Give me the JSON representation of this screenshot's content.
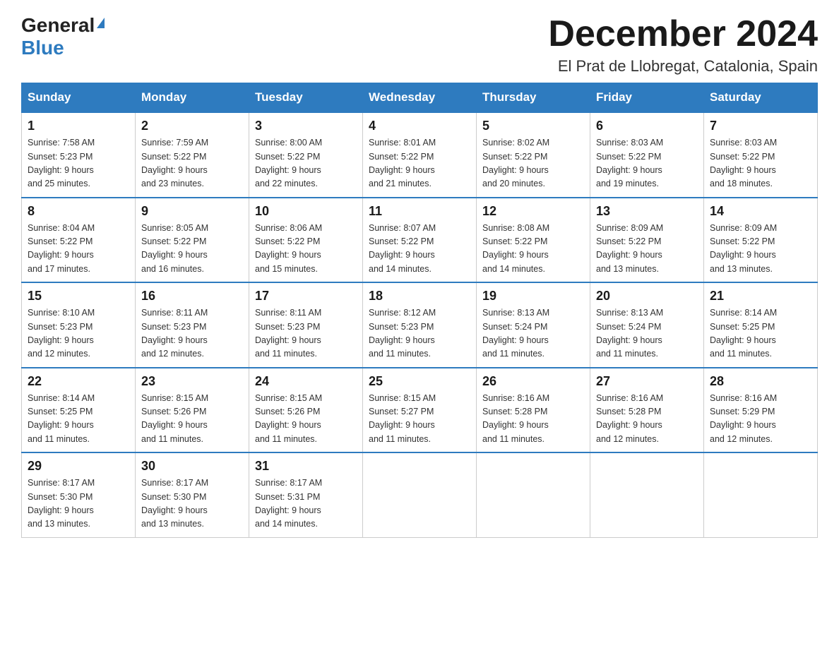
{
  "header": {
    "logo": {
      "general": "General",
      "blue": "Blue",
      "arrow": "▲"
    },
    "title": "December 2024",
    "location": "El Prat de Llobregat, Catalonia, Spain"
  },
  "calendar": {
    "headers": [
      "Sunday",
      "Monday",
      "Tuesday",
      "Wednesday",
      "Thursday",
      "Friday",
      "Saturday"
    ],
    "weeks": [
      [
        {
          "day": "1",
          "info": "Sunrise: 7:58 AM\nSunset: 5:23 PM\nDaylight: 9 hours\nand 25 minutes."
        },
        {
          "day": "2",
          "info": "Sunrise: 7:59 AM\nSunset: 5:22 PM\nDaylight: 9 hours\nand 23 minutes."
        },
        {
          "day": "3",
          "info": "Sunrise: 8:00 AM\nSunset: 5:22 PM\nDaylight: 9 hours\nand 22 minutes."
        },
        {
          "day": "4",
          "info": "Sunrise: 8:01 AM\nSunset: 5:22 PM\nDaylight: 9 hours\nand 21 minutes."
        },
        {
          "day": "5",
          "info": "Sunrise: 8:02 AM\nSunset: 5:22 PM\nDaylight: 9 hours\nand 20 minutes."
        },
        {
          "day": "6",
          "info": "Sunrise: 8:03 AM\nSunset: 5:22 PM\nDaylight: 9 hours\nand 19 minutes."
        },
        {
          "day": "7",
          "info": "Sunrise: 8:03 AM\nSunset: 5:22 PM\nDaylight: 9 hours\nand 18 minutes."
        }
      ],
      [
        {
          "day": "8",
          "info": "Sunrise: 8:04 AM\nSunset: 5:22 PM\nDaylight: 9 hours\nand 17 minutes."
        },
        {
          "day": "9",
          "info": "Sunrise: 8:05 AM\nSunset: 5:22 PM\nDaylight: 9 hours\nand 16 minutes."
        },
        {
          "day": "10",
          "info": "Sunrise: 8:06 AM\nSunset: 5:22 PM\nDaylight: 9 hours\nand 15 minutes."
        },
        {
          "day": "11",
          "info": "Sunrise: 8:07 AM\nSunset: 5:22 PM\nDaylight: 9 hours\nand 14 minutes."
        },
        {
          "day": "12",
          "info": "Sunrise: 8:08 AM\nSunset: 5:22 PM\nDaylight: 9 hours\nand 14 minutes."
        },
        {
          "day": "13",
          "info": "Sunrise: 8:09 AM\nSunset: 5:22 PM\nDaylight: 9 hours\nand 13 minutes."
        },
        {
          "day": "14",
          "info": "Sunrise: 8:09 AM\nSunset: 5:22 PM\nDaylight: 9 hours\nand 13 minutes."
        }
      ],
      [
        {
          "day": "15",
          "info": "Sunrise: 8:10 AM\nSunset: 5:23 PM\nDaylight: 9 hours\nand 12 minutes."
        },
        {
          "day": "16",
          "info": "Sunrise: 8:11 AM\nSunset: 5:23 PM\nDaylight: 9 hours\nand 12 minutes."
        },
        {
          "day": "17",
          "info": "Sunrise: 8:11 AM\nSunset: 5:23 PM\nDaylight: 9 hours\nand 11 minutes."
        },
        {
          "day": "18",
          "info": "Sunrise: 8:12 AM\nSunset: 5:23 PM\nDaylight: 9 hours\nand 11 minutes."
        },
        {
          "day": "19",
          "info": "Sunrise: 8:13 AM\nSunset: 5:24 PM\nDaylight: 9 hours\nand 11 minutes."
        },
        {
          "day": "20",
          "info": "Sunrise: 8:13 AM\nSunset: 5:24 PM\nDaylight: 9 hours\nand 11 minutes."
        },
        {
          "day": "21",
          "info": "Sunrise: 8:14 AM\nSunset: 5:25 PM\nDaylight: 9 hours\nand 11 minutes."
        }
      ],
      [
        {
          "day": "22",
          "info": "Sunrise: 8:14 AM\nSunset: 5:25 PM\nDaylight: 9 hours\nand 11 minutes."
        },
        {
          "day": "23",
          "info": "Sunrise: 8:15 AM\nSunset: 5:26 PM\nDaylight: 9 hours\nand 11 minutes."
        },
        {
          "day": "24",
          "info": "Sunrise: 8:15 AM\nSunset: 5:26 PM\nDaylight: 9 hours\nand 11 minutes."
        },
        {
          "day": "25",
          "info": "Sunrise: 8:15 AM\nSunset: 5:27 PM\nDaylight: 9 hours\nand 11 minutes."
        },
        {
          "day": "26",
          "info": "Sunrise: 8:16 AM\nSunset: 5:28 PM\nDaylight: 9 hours\nand 11 minutes."
        },
        {
          "day": "27",
          "info": "Sunrise: 8:16 AM\nSunset: 5:28 PM\nDaylight: 9 hours\nand 12 minutes."
        },
        {
          "day": "28",
          "info": "Sunrise: 8:16 AM\nSunset: 5:29 PM\nDaylight: 9 hours\nand 12 minutes."
        }
      ],
      [
        {
          "day": "29",
          "info": "Sunrise: 8:17 AM\nSunset: 5:30 PM\nDaylight: 9 hours\nand 13 minutes."
        },
        {
          "day": "30",
          "info": "Sunrise: 8:17 AM\nSunset: 5:30 PM\nDaylight: 9 hours\nand 13 minutes."
        },
        {
          "day": "31",
          "info": "Sunrise: 8:17 AM\nSunset: 5:31 PM\nDaylight: 9 hours\nand 14 minutes."
        },
        {
          "day": "",
          "info": ""
        },
        {
          "day": "",
          "info": ""
        },
        {
          "day": "",
          "info": ""
        },
        {
          "day": "",
          "info": ""
        }
      ]
    ]
  }
}
